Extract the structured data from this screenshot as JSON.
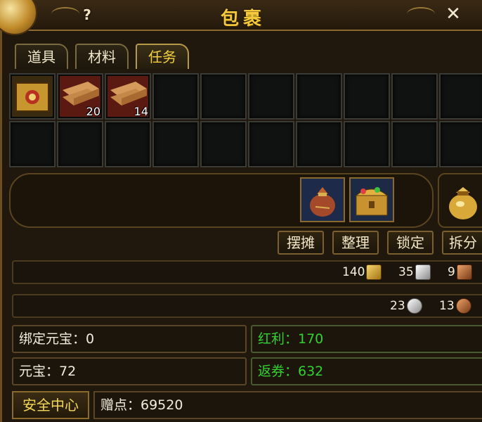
{
  "window": {
    "title": "包裹",
    "help_glyph": "?",
    "close_glyph": "✕"
  },
  "tabs": [
    {
      "label": "道具",
      "active": false
    },
    {
      "label": "材料",
      "active": false
    },
    {
      "label": "任务",
      "active": true
    }
  ],
  "inventory": {
    "slots": [
      {
        "item": "golden-chest-box-icon",
        "count": ""
      },
      {
        "item": "wood-planks-icon",
        "count": "20"
      },
      {
        "item": "wood-planks-icon",
        "count": "14"
      }
    ]
  },
  "special_items": [
    {
      "icon": "cloth-sack-icon"
    },
    {
      "icon": "treasure-chest-icon"
    }
  ],
  "right_slot": {
    "icon": "gold-pouch-icon"
  },
  "actions": {
    "stall": "摆摊",
    "sort": "整理",
    "lock": "锁定",
    "split": "拆分"
  },
  "currency": {
    "gold": "140",
    "silver": "35",
    "copper": "9",
    "silver_coin": "23",
    "copper_coin": "13"
  },
  "accounts": {
    "bound_yuanbao": "绑定元宝：0",
    "bonus": "红利：170",
    "yuanbao": "元宝：72",
    "voucher": "返券：632",
    "safety_center": "安全中心",
    "gift_points": "赠点：69520"
  },
  "colors": {
    "title": "#f3c83a",
    "green_text": "#35d22f",
    "frame": "#6b4e22"
  }
}
